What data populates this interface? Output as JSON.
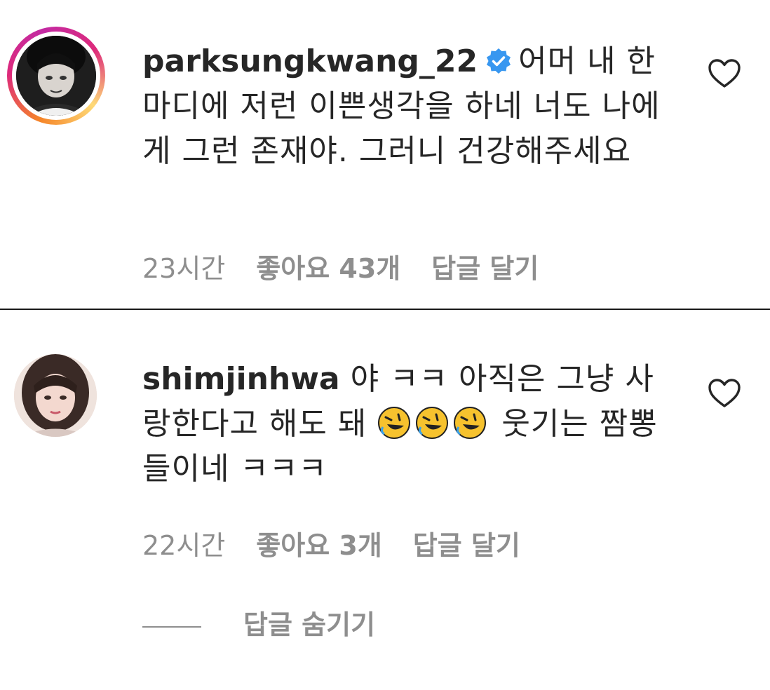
{
  "comments": [
    {
      "username": "parksungkwang_22",
      "verified": true,
      "text": "어머 내 한 마디에 저런 이쁜생각을 하네 너도 나에게 그런 존재야. 그러니 건강해주세요",
      "time": "23시간",
      "likes": "좋아요 43개",
      "reply": "답글 달기",
      "icon": "heart-outline-icon"
    },
    {
      "username": "shimjinhwa",
      "verified": false,
      "text_before": "야 ㅋㅋ 아직은 그냥 사랑한다고 해도 돼",
      "text_after": "웃기는 짬뽕들이네 ㅋㅋㅋ",
      "emoji": "rolling-on-floor-laughing-icon",
      "time": "22시간",
      "likes": "좋아요 3개",
      "reply": "답글 달기",
      "icon": "heart-outline-icon"
    }
  ],
  "hide_replies_label": "답글 숨기기",
  "colors": {
    "text": "#262626",
    "muted": "#8e8e8e",
    "verified": "#3897f0",
    "divider": "#1a1a1a"
  }
}
